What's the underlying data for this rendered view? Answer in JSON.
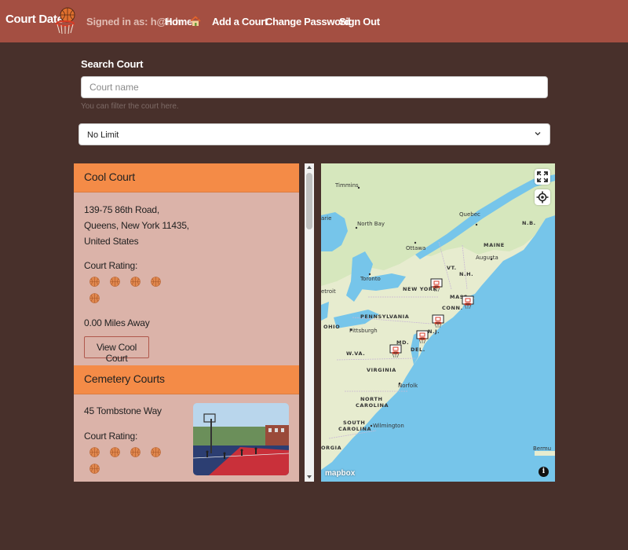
{
  "navbar": {
    "brand": "Court Date",
    "signed_in": "Signed in as: h@h.h",
    "links": {
      "home": "Home",
      "add_court": "Add a Court",
      "change_password": "Change Password",
      "sign_out": "Sign Out"
    }
  },
  "search": {
    "label": "Search Court",
    "placeholder": "Court name",
    "help": "You can filter the court here.",
    "distance_selected": "No Limit"
  },
  "courts": [
    {
      "name": "Cool Court",
      "address_lines": [
        "139-75 86th Road,",
        "Queens, New York 11435,",
        "United States"
      ],
      "rating_label": "Court Rating:",
      "rating": 5,
      "distance": "0.00 Miles Away",
      "view_label": "View Cool Court"
    },
    {
      "name": "Cemetery Courts",
      "address_lines": [
        "45 Tombstone Way"
      ],
      "rating_label": "Court Rating:",
      "rating": 5,
      "has_photo": true
    }
  ],
  "map": {
    "labels": {
      "timmins": "Timmins",
      "arie": "arie",
      "north_bay": "North Bay",
      "quebec": "Quebec",
      "nb": "N.B.",
      "ottawa": "Ottawa",
      "maine": "MAINE",
      "augusta": "Augusta",
      "vt": "VT.",
      "nh": "N.H.",
      "toronto": "Toronto",
      "new_york": "NEW YORK",
      "mass": "MASS.",
      "conn": "CONN.",
      "etroit": "etroit",
      "pennsylvania": "PENNSYLVANIA",
      "ohio": "OHIO",
      "pittsburgh": "Pittsburgh",
      "md": "MD.",
      "nj": "N.J.",
      "del": "DEL.",
      "wva": "W.VA.",
      "virginia": "VIRGINIA",
      "norfolk": "Norfolk",
      "north_carolina_1": "NORTH",
      "north_carolina_2": "CAROLINA",
      "south_carolina_1": "SOUTH",
      "south_carolina_2": "CAROLINA",
      "wilmington": "Wilmington",
      "orgia": "ORGIA",
      "bermu": "Bermu"
    },
    "attribution": "mapbox",
    "colors": {
      "water": "#76c5ea",
      "land": "#e7eccf",
      "forest": "#cfe3b4"
    }
  },
  "colors": {
    "navbar": "#a44f42",
    "background": "#48302b",
    "card_header": "#f48b47",
    "card_body": "#dbb3a9"
  }
}
